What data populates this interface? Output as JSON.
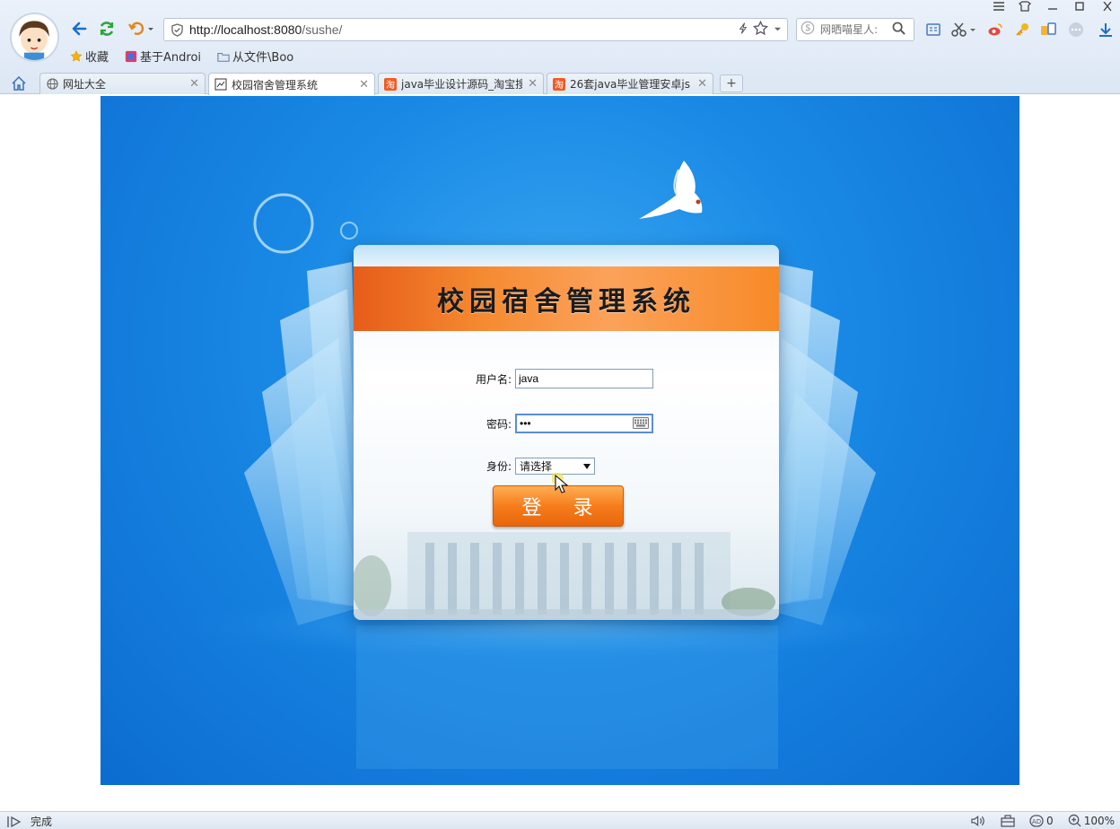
{
  "window": {
    "controls": [
      "menu-icon",
      "skin-icon",
      "minimize-icon",
      "maximize-icon",
      "close-icon"
    ]
  },
  "address_bar": {
    "url_host": "http://localhost:8080",
    "url_path": "/sushe/"
  },
  "search": {
    "placeholder": "网晒喵星人:"
  },
  "bookmarks": [
    {
      "label": "收藏",
      "icon": "star-icon"
    },
    {
      "label": "基于Androi",
      "icon": "app-icon"
    },
    {
      "label": "从文件\\Boo",
      "icon": "folder-icon"
    }
  ],
  "tabs": [
    {
      "label": "网址大全",
      "icon": "globe-icon",
      "active": false
    },
    {
      "label": "校园宿舍管理系统",
      "icon": "page-icon",
      "active": true
    },
    {
      "label": "java毕业设计源码_淘宝搜",
      "icon": "taobao-icon",
      "active": false
    },
    {
      "label": "26套java毕业管理安卓js",
      "icon": "taobao-icon",
      "active": false
    }
  ],
  "new_tab_label": "+",
  "login": {
    "title": "校园宿舍管理系统",
    "username_label": "用户名:",
    "username_value": "java",
    "password_label": "密码:",
    "password_value": "•••",
    "role_label": "身份:",
    "role_selected": "请选择",
    "submit_label": "登 录"
  },
  "status": {
    "text": "完成",
    "blocked_count": "0",
    "zoom": "100%"
  },
  "colors": {
    "background_blue": "#1a8ae6",
    "banner_orange": "#f58a30",
    "button_orange": "#f67d1b"
  }
}
